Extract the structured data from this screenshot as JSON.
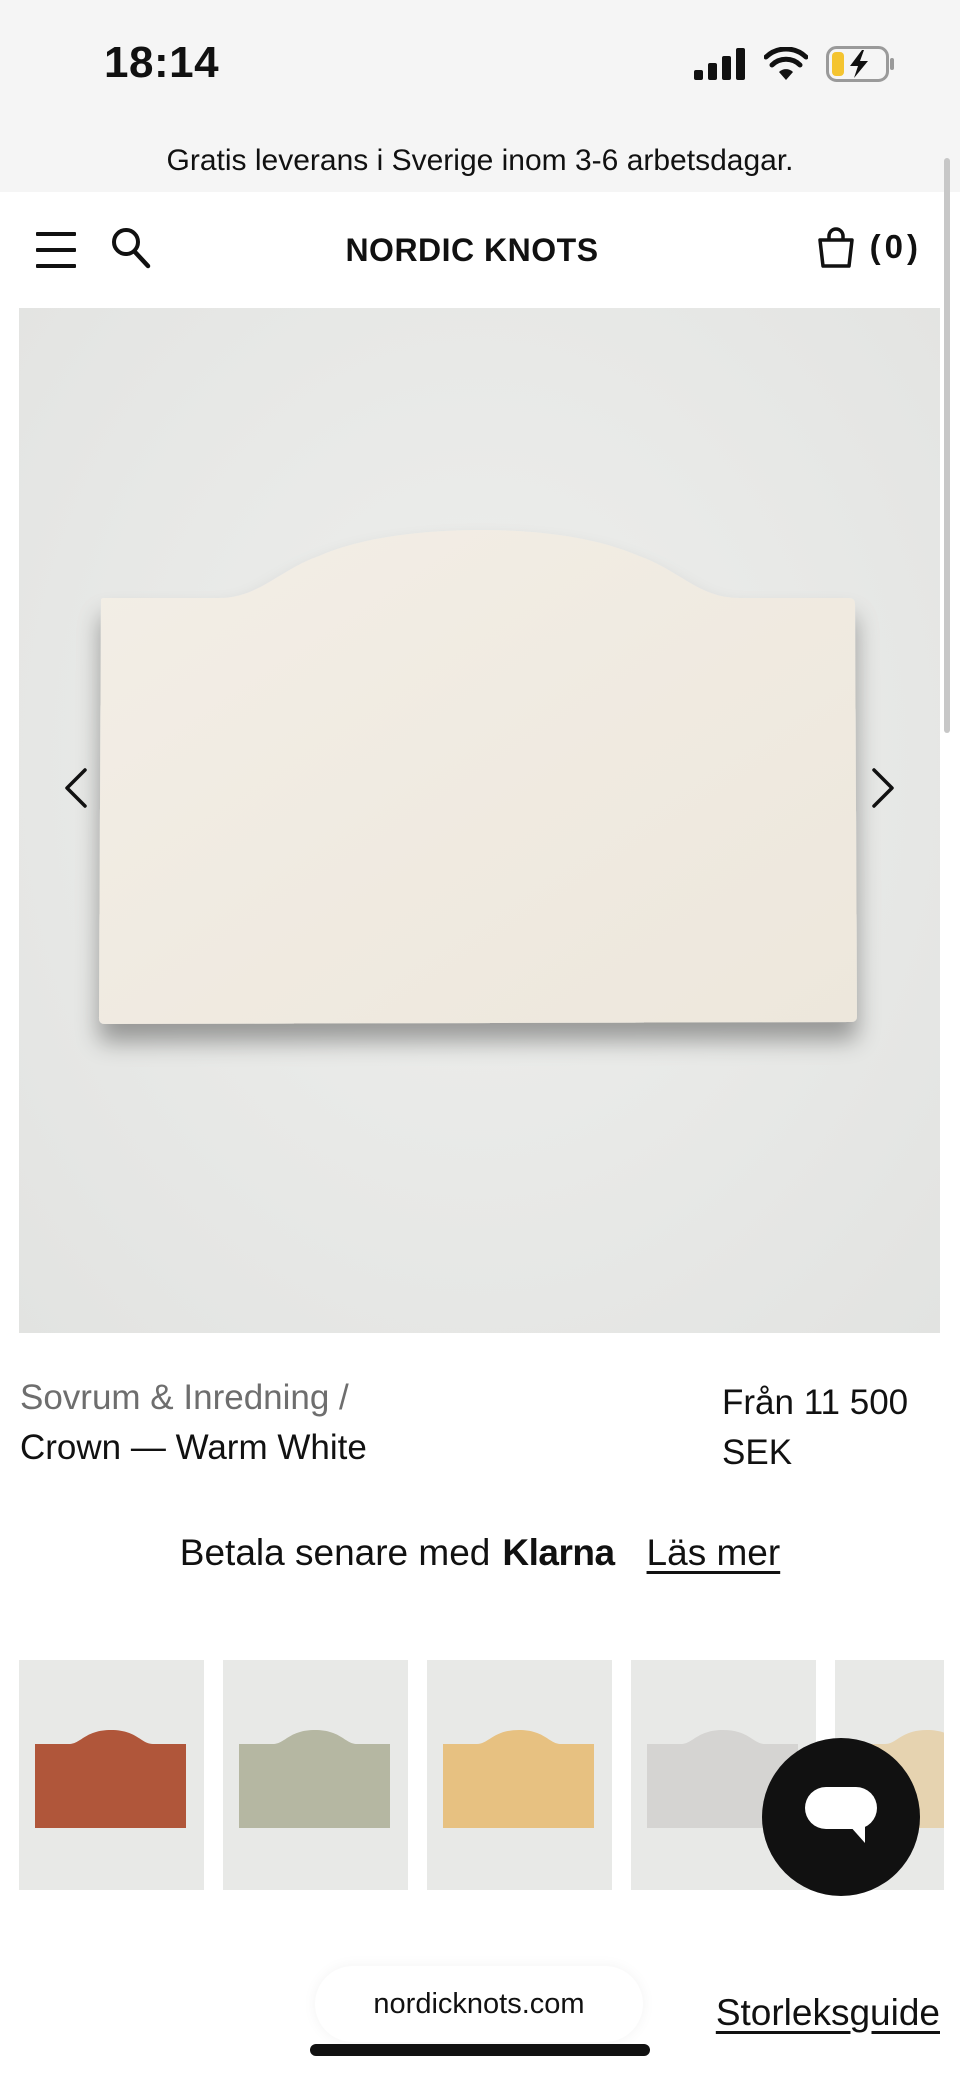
{
  "status_bar": {
    "time": "18:14"
  },
  "promo": {
    "text": "Gratis leverans i Sverige inom 3-6 arbetsdagar."
  },
  "header": {
    "brand": "NORDIC KNOTS",
    "cart_count": "(0)"
  },
  "product": {
    "breadcrumb": "Sovrum & Inredning /",
    "name": "Crown — Warm White",
    "price_line1": "Från 11 500",
    "price_line2": "SEK",
    "main_color": "#f1ece4"
  },
  "klarna": {
    "prefix": "Betala senare med",
    "brand": "Klarna",
    "link": "Läs mer"
  },
  "swatches": [
    {
      "color": "#b0563a"
    },
    {
      "color": "#b5b7a2"
    },
    {
      "color": "#e7c181"
    },
    {
      "color": "#d5d4d2"
    },
    {
      "color": "#e6d3b0"
    }
  ],
  "footer": {
    "url": "nordicknots.com",
    "size_guide": "Storleksguide"
  }
}
